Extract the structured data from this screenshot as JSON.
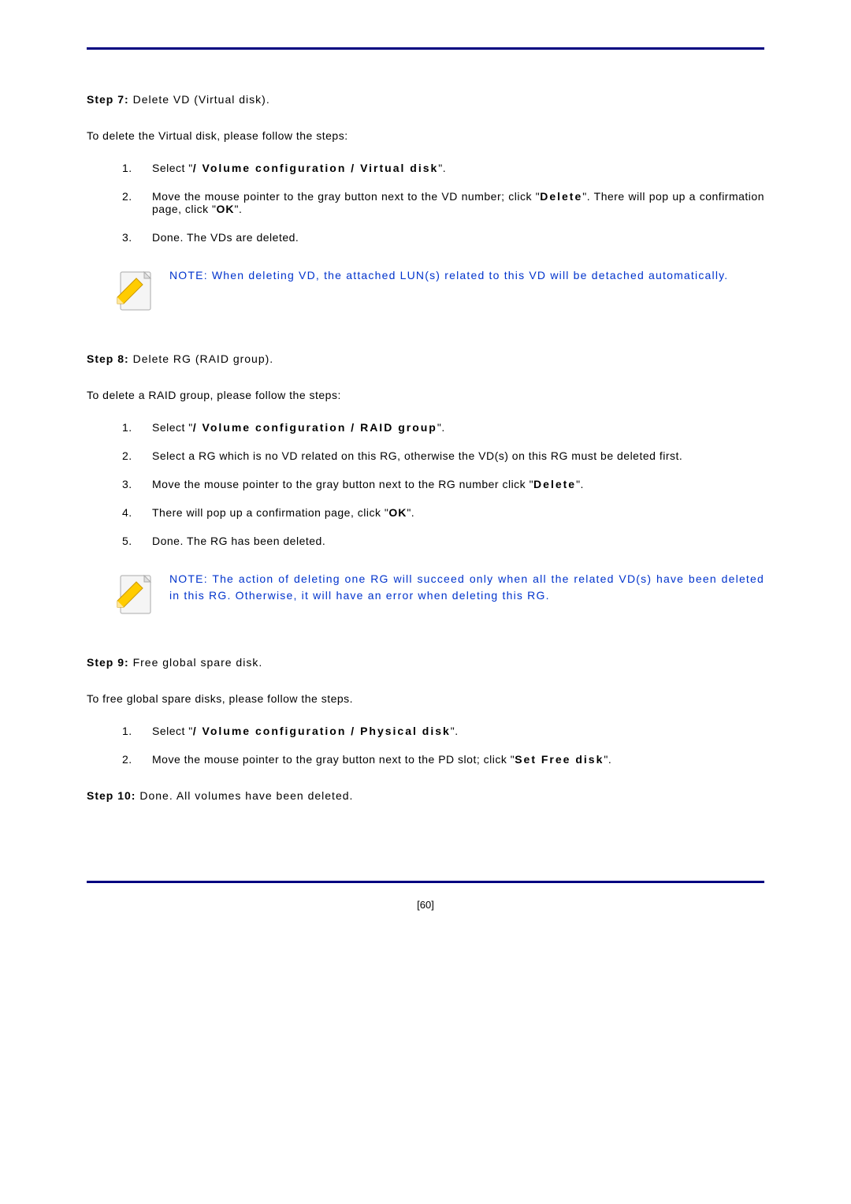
{
  "step7": {
    "title_label": "Step 7:",
    "title_rest": " Delete VD (Virtual disk).",
    "intro": "To delete the Virtual disk, please follow the steps:",
    "items": [
      {
        "num": "1.",
        "pre": "Select \"",
        "path": "/ Volume configuration / Virtual disk",
        "post": "\"."
      },
      {
        "num": "2.",
        "text1": "Move the mouse pointer to the gray button next to the VD number; click \"",
        "action": "Delete",
        "text2": "\". There will pop up a confirmation page, click \"",
        "ok": "OK",
        "text3": "\"."
      },
      {
        "num": "3.",
        "text": "Done. The VDs are deleted."
      }
    ],
    "note": "NOTE: When deleting VD, the attached LUN(s) related to this VD will be detached automatically."
  },
  "step8": {
    "title_label": "Step 8:",
    "title_rest": " Delete RG (RAID group).",
    "intro": "To delete a RAID group, please follow the steps:",
    "items": [
      {
        "num": "1.",
        "pre": "Select \"",
        "path": "/ Volume configuration / RAID group",
        "post": "\"."
      },
      {
        "num": "2.",
        "text": "Select a RG which is no VD related on this RG, otherwise the VD(s) on this RG must be deleted first."
      },
      {
        "num": "3.",
        "text1": "Move the mouse pointer to the gray button next to the RG number click \"",
        "action": "Delete",
        "text2": "\"."
      },
      {
        "num": "4.",
        "text1": "There will pop up a confirmation page, click \"",
        "ok": "OK",
        "text2": "\"."
      },
      {
        "num": "5.",
        "text": "Done. The RG has been deleted."
      }
    ],
    "note": "NOTE: The action of deleting one RG will succeed only when all the related VD(s) have been deleted in this RG. Otherwise, it will have an error when deleting this RG."
  },
  "step9": {
    "title_label": "Step 9:",
    "title_rest": " Free global spare disk.",
    "intro": "To free global spare disks, please follow the steps.",
    "items": [
      {
        "num": "1.",
        "pre": "Select \"",
        "path": "/ Volume configuration / Physical disk",
        "post": "\"."
      },
      {
        "num": "2.",
        "text1": "Move the mouse pointer to the gray button next to the PD slot; click \"",
        "action": "Set Free disk",
        "text2": "\"."
      }
    ]
  },
  "step10": {
    "title_label": "Step 10:",
    "title_rest": " Done. All volumes have been deleted."
  },
  "page_number": "[60]"
}
